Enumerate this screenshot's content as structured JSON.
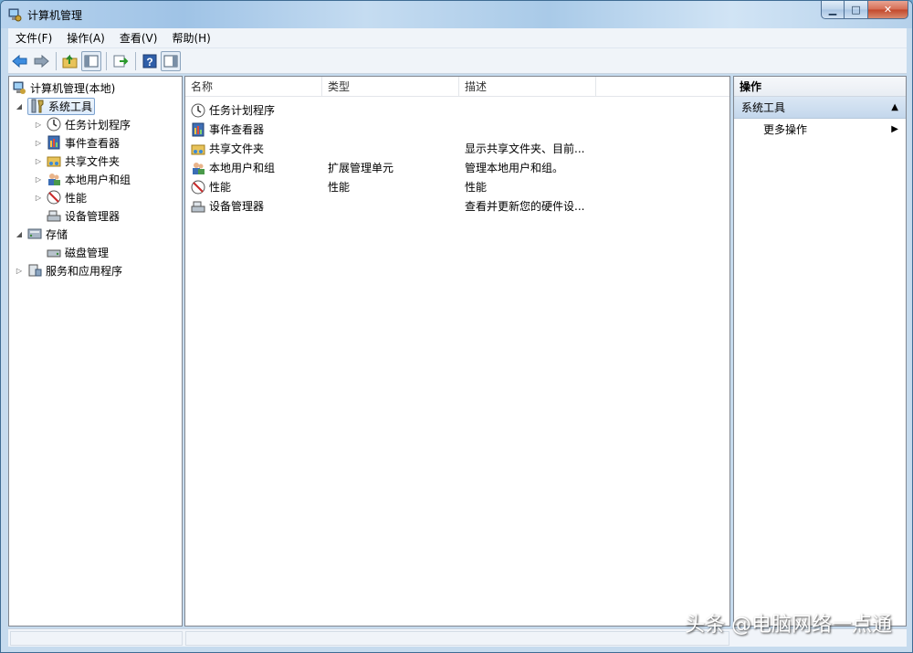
{
  "window": {
    "title": "计算机管理"
  },
  "menu": [
    {
      "label": "文件(F)"
    },
    {
      "label": "操作(A)"
    },
    {
      "label": "查看(V)"
    },
    {
      "label": "帮助(H)"
    }
  ],
  "tree": {
    "root": "计算机管理(本地)",
    "system_tools": "系统工具",
    "children": [
      "任务计划程序",
      "事件查看器",
      "共享文件夹",
      "本地用户和组",
      "性能",
      "设备管理器"
    ],
    "storage": "存储",
    "disk_mgmt": "磁盘管理",
    "services": "服务和应用程序"
  },
  "list": {
    "columns": [
      "名称",
      "类型",
      "描述"
    ],
    "rows": [
      {
        "name": "任务计划程序",
        "type": "",
        "desc": ""
      },
      {
        "name": "事件查看器",
        "type": "",
        "desc": ""
      },
      {
        "name": "共享文件夹",
        "type": "",
        "desc": "显示共享文件夹、目前..."
      },
      {
        "name": "本地用户和组",
        "type": "扩展管理单元",
        "desc": "管理本地用户和组。"
      },
      {
        "name": "性能",
        "type": "性能",
        "desc": "性能"
      },
      {
        "name": "设备管理器",
        "type": "",
        "desc": "查看并更新您的硬件设..."
      }
    ]
  },
  "actions": {
    "header": "操作",
    "section": "系统工具",
    "more": "更多操作"
  },
  "watermark": "头条 @电脑网络一点通"
}
